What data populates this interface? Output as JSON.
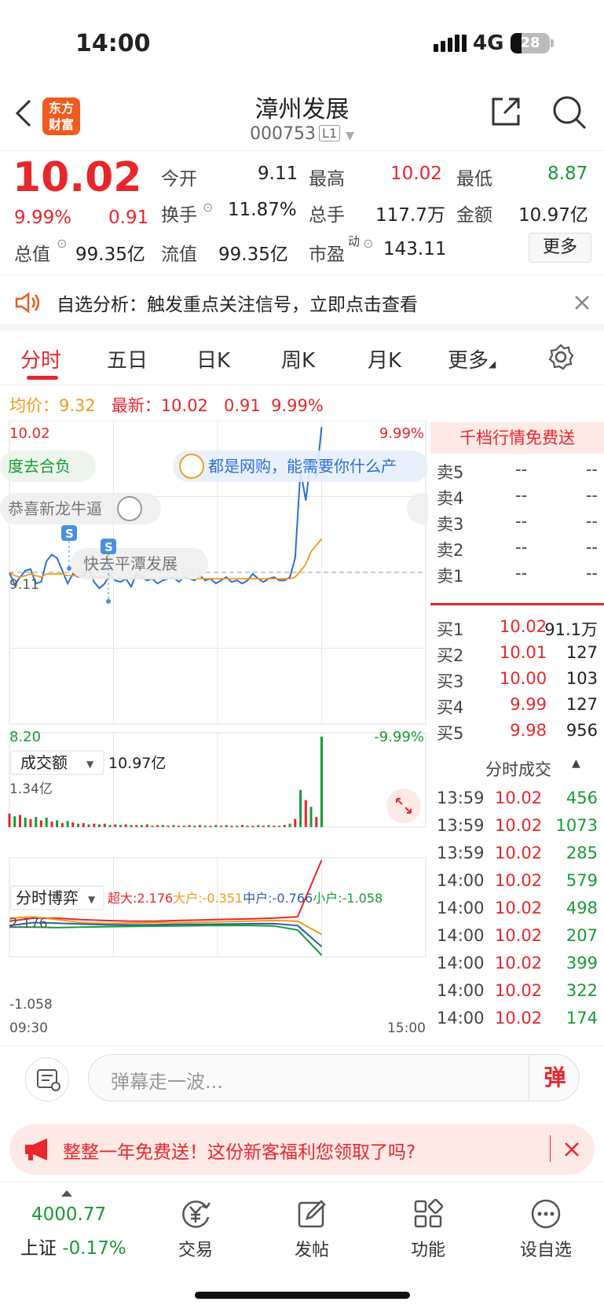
{
  "status": {
    "time": "14:00",
    "network": "4G",
    "battery": "28",
    "battery_level": 0.28
  },
  "nav": {
    "title": "漳州发展",
    "code": "000753",
    "level": "L1",
    "logo": "东方财富"
  },
  "quote": {
    "price": "10.02",
    "pct": "9.99%",
    "change": "0.91",
    "open_label": "今开",
    "open": "9.11",
    "high_label": "最高",
    "high": "10.02",
    "low_label": "最低",
    "low": "8.87",
    "turnover_label": "换手",
    "turnover": "11.87%",
    "vol_label": "总手",
    "vol": "117.7万",
    "amount_label": "金额",
    "amount": "10.97亿",
    "mcap_label": "总值",
    "mcap": "99.35亿",
    "float_label": "流值",
    "float": "99.35亿",
    "pe_label": "市盈",
    "pe_sup": "动",
    "pe": "143.11",
    "more_label": "更多"
  },
  "notice": {
    "text": "自选分析：触发重点关注信号，立即点击查看"
  },
  "tabs": [
    {
      "label": "分时"
    },
    {
      "label": "五日"
    },
    {
      "label": "日K"
    },
    {
      "label": "周K"
    },
    {
      "label": "月K"
    },
    {
      "label": "更多"
    }
  ],
  "avg": {
    "avg_label": "均价：",
    "avg": "9.32",
    "last_label": "最新：",
    "last": "10.02",
    "chg": "0.91",
    "pct": "9.99%"
  },
  "chart_data": {
    "type": "line",
    "series": [
      {
        "name": "最新",
        "values": [
          9.11,
          9.03,
          9.08,
          9.12,
          9.13,
          9.04,
          9.05,
          9.18,
          9.22,
          9.2,
          9.12,
          9.04,
          9.1,
          9.08,
          9.09,
          9.13,
          9.05,
          9.01,
          9.04,
          9.1,
          9.06,
          9.05,
          9.07,
          9.02,
          9.1,
          9.08,
          9.06,
          9.07,
          9.04,
          9.06,
          9.07,
          9.08,
          9.05,
          9.08,
          9.07,
          9.06,
          9.09,
          9.06,
          9.07,
          9.04,
          9.06,
          9.08,
          9.05,
          9.06,
          9.04,
          9.06,
          9.1,
          9.07,
          9.05,
          9.07,
          9.08,
          9.06,
          9.06,
          9.08,
          9.2,
          9.75,
          9.56,
          9.82,
          9.7,
          10.02
        ]
      },
      {
        "name": "均价",
        "values": [
          9.11,
          9.09,
          9.08,
          9.09,
          9.1,
          9.09,
          9.08,
          9.1,
          9.1,
          9.1,
          9.1,
          9.09,
          9.09,
          9.09,
          9.09,
          9.08,
          9.08,
          9.08,
          9.08,
          9.07,
          9.07,
          9.07,
          9.07,
          9.07,
          9.07,
          9.07,
          9.07,
          9.07,
          9.07,
          9.07,
          9.07,
          9.07,
          9.07,
          9.07,
          9.07,
          9.07,
          9.07,
          9.07,
          9.07,
          9.07,
          9.07,
          9.07,
          9.07,
          9.07,
          9.07,
          9.07,
          9.07,
          9.07,
          9.07,
          9.07,
          9.07,
          9.07,
          9.07,
          9.07,
          9.08,
          9.12,
          9.16,
          9.24,
          9.28,
          9.32
        ]
      }
    ],
    "ylim": [
      8.2,
      10.02
    ],
    "prev_close": "9.11",
    "y_top": "10.02",
    "y_bottom": "8.20",
    "pct_top": "9.99%",
    "pct_bottom": "-9.99%",
    "x_start": "09:30",
    "x_end": "15:00",
    "volume_label": "成交额",
    "volume_total": "10.97亿",
    "volume_max": "1.34亿",
    "volume": [
      0.2,
      0.16,
      0.18,
      0.14,
      0.12,
      0.15,
      0.1,
      0.14,
      0.08,
      0.1,
      0.06,
      0.09,
      0.07,
      0.05,
      0.06,
      0.04,
      0.05,
      0.04,
      0.05,
      0.03,
      0.04,
      0.03,
      0.04,
      0.03,
      0.03,
      0.03,
      0.04,
      0.02,
      0.03,
      0.03,
      0.02,
      0.03,
      0.02,
      0.02,
      0.03,
      0.02,
      0.03,
      0.02,
      0.02,
      0.03,
      0.02,
      0.03,
      0.02,
      0.02,
      0.03,
      0.02,
      0.02,
      0.03,
      0.02,
      0.03,
      0.02,
      0.02,
      0.03,
      0.05,
      0.12,
      0.55,
      0.4,
      0.3,
      0.15,
      1.34
    ],
    "flow_label": "分时博弈",
    "flow_legend": [
      {
        "label": "超大",
        "value": "2.176"
      },
      {
        "label": "大户",
        "value": "-0.351"
      },
      {
        "label": "中户",
        "value": "-0.766"
      },
      {
        "label": "小户",
        "value": "-1.058"
      }
    ],
    "flow_max": "2.176",
    "flow_min": "-1.058",
    "flow": {
      "超大": [
        0.1,
        0.2,
        0.2,
        0.15,
        0.12,
        0.1,
        0.1,
        0.12,
        0.14,
        0.16,
        0.18,
        0.2,
        0.25,
        2.176
      ],
      "大户": [
        0.2,
        0.25,
        0.15,
        0.05,
        0.02,
        0.03,
        0.05,
        0.05,
        0.06,
        0.08,
        0.1,
        0.12,
        0.1,
        -0.351
      ],
      "中户": [
        -0.05,
        0.05,
        0.03,
        0.0,
        -0.02,
        -0.03,
        -0.02,
        -0.01,
        -0.01,
        0.0,
        0.01,
        0.02,
        -0.05,
        -0.766
      ],
      "小户": [
        -0.1,
        -0.1,
        -0.12,
        -0.1,
        -0.09,
        -0.08,
        -0.07,
        -0.06,
        -0.05,
        -0.05,
        -0.05,
        -0.06,
        -0.2,
        -1.058
      ]
    },
    "danmaku": [
      "度去合负",
      "都是网购，能需要你什么产",
      "恭喜新龙牛逼",
      "快去平潭发展"
    ]
  },
  "orderbook": {
    "banner": "千档行情免费送",
    "asks": [
      {
        "label": "卖5",
        "price": "--",
        "vol": "--"
      },
      {
        "label": "卖4",
        "price": "--",
        "vol": "--"
      },
      {
        "label": "卖3",
        "price": "--",
        "vol": "--"
      },
      {
        "label": "卖2",
        "price": "--",
        "vol": "--"
      },
      {
        "label": "卖1",
        "price": "--",
        "vol": "--"
      }
    ],
    "bids": [
      {
        "label": "买1",
        "price": "10.02",
        "vol": "91.1万"
      },
      {
        "label": "买2",
        "price": "10.01",
        "vol": "127"
      },
      {
        "label": "买3",
        "price": "10.00",
        "vol": "103"
      },
      {
        "label": "买4",
        "price": "9.99",
        "vol": "127"
      },
      {
        "label": "买5",
        "price": "9.98",
        "vol": "956"
      }
    ],
    "trades_label": "分时成交",
    "trades": [
      {
        "t": "13:59",
        "p": "10.02",
        "v": "456"
      },
      {
        "t": "13:59",
        "p": "10.02",
        "v": "1073"
      },
      {
        "t": "13:59",
        "p": "10.02",
        "v": "285"
      },
      {
        "t": "14:00",
        "p": "10.02",
        "v": "579"
      },
      {
        "t": "14:00",
        "p": "10.02",
        "v": "498"
      },
      {
        "t": "14:00",
        "p": "10.02",
        "v": "207"
      },
      {
        "t": "14:00",
        "p": "10.02",
        "v": "399"
      },
      {
        "t": "14:00",
        "p": "10.02",
        "v": "322"
      },
      {
        "t": "14:00",
        "p": "10.02",
        "v": "174"
      }
    ]
  },
  "danmu": {
    "placeholder": "弹幕走一波...",
    "send": "弹"
  },
  "promo": {
    "text": "整整一年免费送！这份新客福利您领取了吗?"
  },
  "bottom": {
    "index_value": "4000.77",
    "index_name": "上证",
    "index_pct": "-0.17%",
    "trade": "交易",
    "post": "发帖",
    "func": "功能",
    "watch": "设自选"
  },
  "colors": {
    "up": "#e8262b",
    "down": "#1a9a36",
    "avg": "#f39a1b",
    "price_line": "#2e6fd2"
  }
}
